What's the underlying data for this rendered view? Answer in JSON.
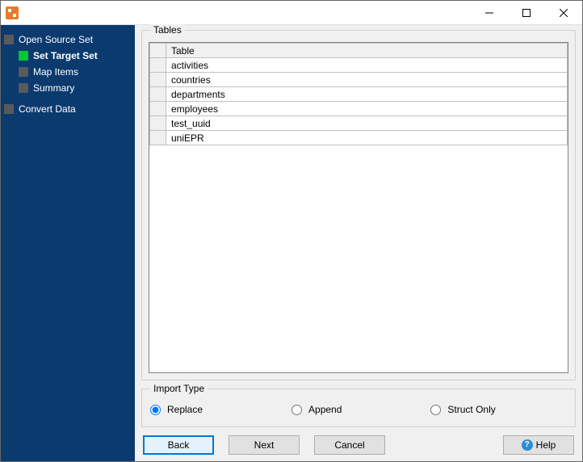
{
  "sidebar": {
    "items": [
      {
        "label": "Open Source Set",
        "indent": 0,
        "active": false,
        "bold": false
      },
      {
        "label": "Set Target Set",
        "indent": 1,
        "active": true,
        "bold": true
      },
      {
        "label": "Map Items",
        "indent": 1,
        "active": false,
        "bold": false
      },
      {
        "label": "Summary",
        "indent": 1,
        "active": false,
        "bold": false
      },
      {
        "label": "Convert Data",
        "indent": 0,
        "active": false,
        "bold": false
      }
    ]
  },
  "tables_group": {
    "title": "Tables",
    "header": "Table",
    "rows": [
      "activities",
      "countries",
      "departments",
      "employees",
      "test_uuid",
      "uniEPR"
    ]
  },
  "import_group": {
    "title": "Import Type",
    "options": [
      {
        "label": "Replace",
        "checked": true
      },
      {
        "label": "Append",
        "checked": false
      },
      {
        "label": "Struct Only",
        "checked": false
      }
    ]
  },
  "buttons": {
    "back": "Back",
    "next": "Next",
    "cancel": "Cancel",
    "help": "Help"
  }
}
